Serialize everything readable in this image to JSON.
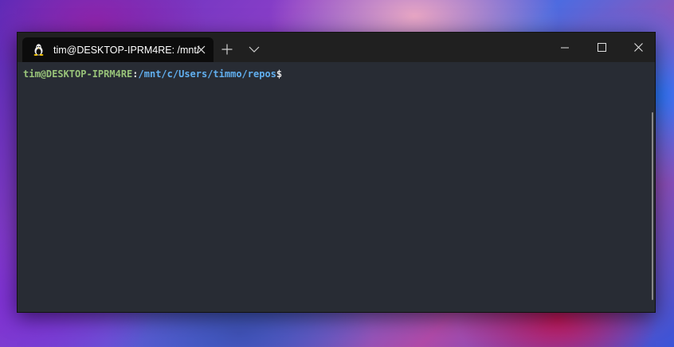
{
  "tab": {
    "title": "tim@DESKTOP-IPRM4RE: /mnt/",
    "icon": "linux-penguin-icon"
  },
  "terminal": {
    "user_host": "tim@DESKTOP-IPRM4RE",
    "colon": ":",
    "path": "/mnt/c/Users/timmo/repos",
    "dollar": "$"
  },
  "colors": {
    "prompt_user": "#98c379",
    "prompt_path": "#61afef",
    "terminal_bg": "#282c34",
    "titlebar_bg": "#202020",
    "tab_bg": "#0c0c0c"
  }
}
